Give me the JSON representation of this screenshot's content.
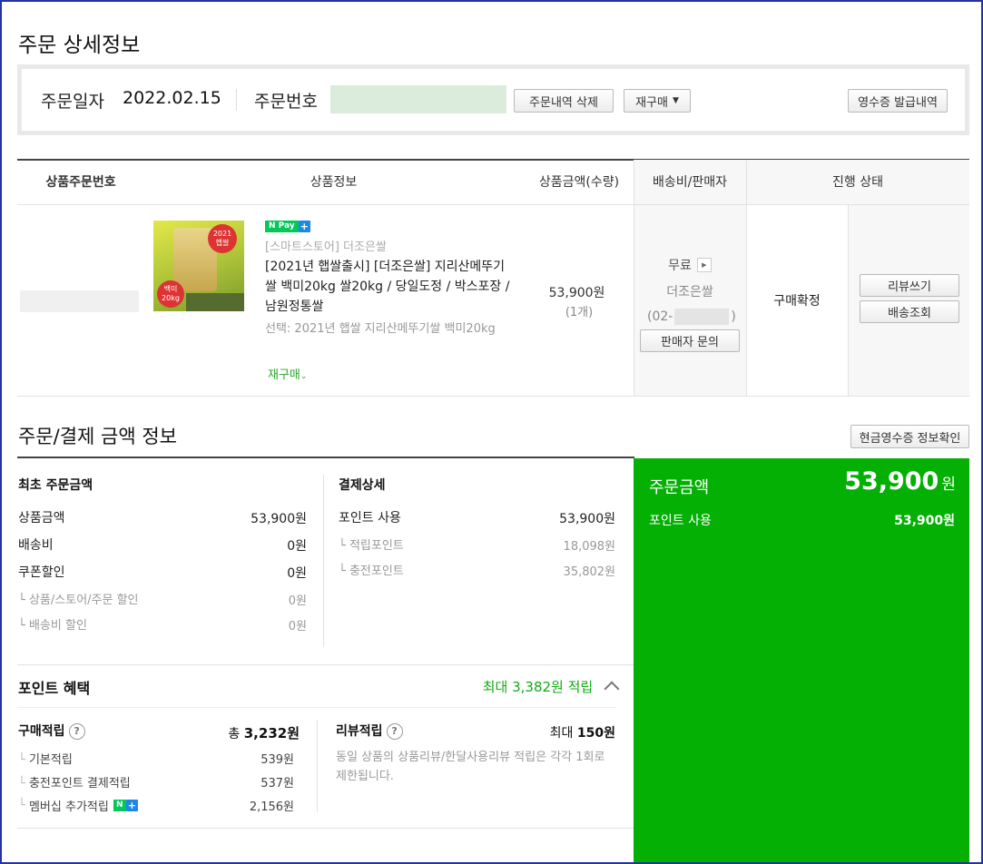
{
  "page_title": "주문 상세정보",
  "order_header": {
    "date_label": "주문일자",
    "date_value": "2022.02.15",
    "number_label": "주문번호",
    "delete_button": "주문내역 삭제",
    "reorder_button": "재구매",
    "receipt_button": "영수증 발급내역"
  },
  "table": {
    "headers": [
      "상품주문번호",
      "상품정보",
      "상품금액(수량)",
      "배송비/판매자",
      "진행 상태"
    ]
  },
  "product": {
    "image_text_1": "2021",
    "image_text_2": "햅쌀",
    "image_text_3": "백미",
    "image_text_4": "20kg",
    "npay_badge": "N Pay",
    "store_line": "[스마트스토어] 더조은쌀",
    "name": "[2021년 햅쌀출시] [더조은쌀] 지리산메뚜기쌀 백미20kg 쌀20kg / 당일도정 / 박스포장 / 남원정통쌀",
    "option": "선택: 2021년 햅쌀 지리산메뚜기쌀 백미20kg",
    "reorder_link": "재구매",
    "price": "53,900원",
    "qty": "(1개)"
  },
  "shipping": {
    "fee": "무료",
    "seller": "더조은쌀",
    "phone_prefix": "(02-",
    "phone_suffix": ")",
    "inquiry_button": "판매자 문의"
  },
  "status": {
    "state": "구매확정",
    "review_button": "리뷰쓰기",
    "tracking_button": "배송조회"
  },
  "payment_section": {
    "title": "주문/결제 금액 정보",
    "cash_receipt_button": "현금영수증 정보확인",
    "initial": {
      "title": "최초 주문금액",
      "rows": [
        {
          "label": "상품금액",
          "value": "53,900원"
        },
        {
          "label": "배송비",
          "value": "0원"
        },
        {
          "label": "쿠폰할인",
          "value": "0원"
        }
      ],
      "subrows": [
        {
          "label": "상품/스토어/주문 할인",
          "value": "0원"
        },
        {
          "label": "배송비 할인",
          "value": "0원"
        }
      ]
    },
    "detail": {
      "title": "결제상세",
      "rows": [
        {
          "label": "포인트 사용",
          "value": "53,900원"
        }
      ],
      "subrows": [
        {
          "label": "적립포인트",
          "value": "18,098원"
        },
        {
          "label": "충전포인트",
          "value": "35,802원"
        }
      ]
    },
    "summary": {
      "label": "주문금액",
      "amount": "53,900",
      "unit": "원",
      "sub_label": "포인트 사용",
      "sub_value": "53,900원",
      "bg_color": "#03b003"
    }
  },
  "points": {
    "title": "포인트 혜택",
    "max_text": "최대 3,382원 적립",
    "purchase": {
      "title": "구매적립",
      "help": "?",
      "total_prefix": "총",
      "total": "3,232원",
      "rows": [
        {
          "label": "기본적립",
          "value": "539원"
        },
        {
          "label": "충전포인트 결제적립",
          "value": "537원"
        },
        {
          "label": "멤버십 추가적립",
          "value": "2,156원"
        }
      ],
      "membership_badge": "N"
    },
    "review": {
      "title": "리뷰적립",
      "help": "?",
      "max_prefix": "최대",
      "max": "150원",
      "note": "동일 상품의 상품리뷰/한달사용리뷰 적립은 각각 1회로 제한됩니다."
    }
  }
}
